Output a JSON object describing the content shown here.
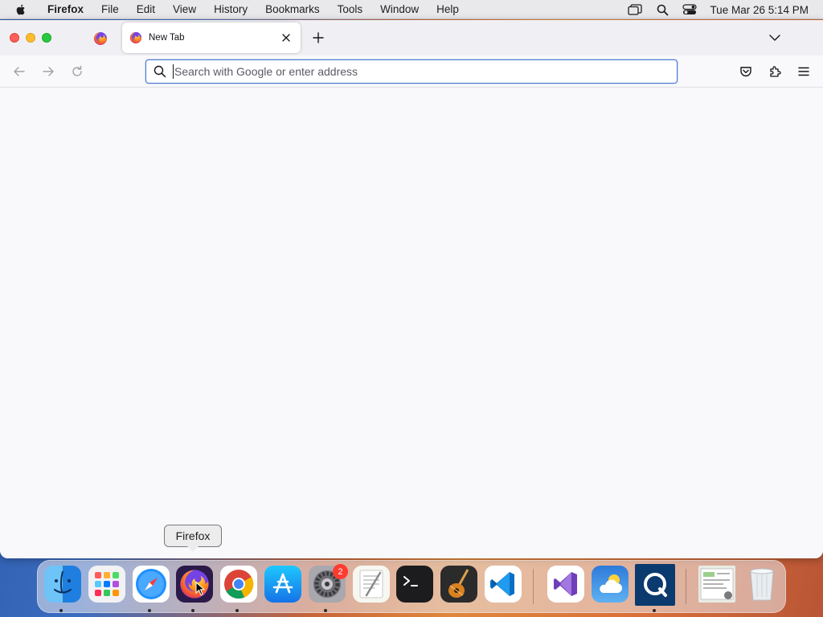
{
  "menubar": {
    "app_name": "Firefox",
    "items": [
      "File",
      "Edit",
      "View",
      "History",
      "Bookmarks",
      "Tools",
      "Window",
      "Help"
    ],
    "clock": "Tue Mar 26  5:14 PM",
    "status_icons": [
      "screen-mirroring-icon",
      "spotlight-search-icon",
      "control-center-icon"
    ]
  },
  "browser": {
    "tabs": [
      {
        "title": "New Tab",
        "active": true
      }
    ],
    "urlbar": {
      "placeholder": "Search with Google or enter address",
      "value": ""
    },
    "toolbar_icons": [
      "back-icon",
      "forward-icon",
      "reload-icon",
      "pocket-icon",
      "extensions-icon",
      "menu-icon"
    ]
  },
  "dock": {
    "tooltip": "Firefox",
    "apps": [
      {
        "name": "Finder",
        "icon": "finder-icon",
        "running": true
      },
      {
        "name": "Launchpad",
        "icon": "launchpad-icon",
        "running": false
      },
      {
        "name": "Safari",
        "icon": "safari-icon",
        "running": true
      },
      {
        "name": "Firefox",
        "icon": "firefox-icon",
        "running": true
      },
      {
        "name": "Google Chrome",
        "icon": "chrome-icon",
        "running": true
      },
      {
        "name": "App Store",
        "icon": "app-store-icon",
        "running": false
      },
      {
        "name": "System Settings",
        "icon": "settings-icon",
        "running": true,
        "badge": "2"
      },
      {
        "name": "TextEdit",
        "icon": "textedit-icon",
        "running": false
      },
      {
        "name": "Terminal",
        "icon": "terminal-icon",
        "running": false
      },
      {
        "name": "GarageBand",
        "icon": "garageband-icon",
        "running": false
      },
      {
        "name": "Visual Studio Code",
        "icon": "vscode-icon",
        "running": false
      },
      {
        "name": "Visual Studio",
        "icon": "visual-studio-icon",
        "running": false
      },
      {
        "name": "Weather",
        "icon": "weather-icon",
        "running": false
      },
      {
        "name": "QuickTime",
        "icon": "quicktime-icon",
        "running": true
      },
      {
        "name": "Downloads",
        "icon": "downloads-stack-icon",
        "running": false
      },
      {
        "name": "Trash",
        "icon": "trash-icon",
        "running": false
      }
    ]
  },
  "colors": {
    "accent": "#4a7bd4",
    "badge": "#ff3b30"
  }
}
